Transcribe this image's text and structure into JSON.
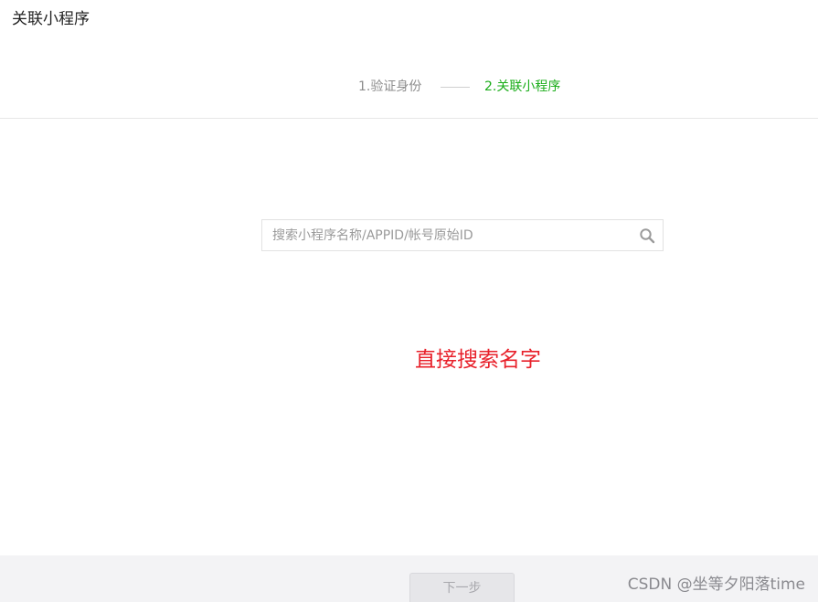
{
  "header": {
    "title": "关联小程序"
  },
  "steps": {
    "step1_label": "1.验证身份",
    "step2_label": "2.关联小程序"
  },
  "search": {
    "placeholder": "搜索小程序名称/APPID/帐号原始ID",
    "value": ""
  },
  "annotation": {
    "text": "直接搜索名字",
    "color": "#e8202a"
  },
  "footer": {
    "next_label": "下一步",
    "watermark": "CSDN @坐等夕阳落time"
  },
  "colors": {
    "active_step": "#1aad19",
    "inactive_step": "#8c8c8c",
    "footer_bg": "#f3f3f5"
  },
  "icons": {
    "search": "search-icon"
  }
}
